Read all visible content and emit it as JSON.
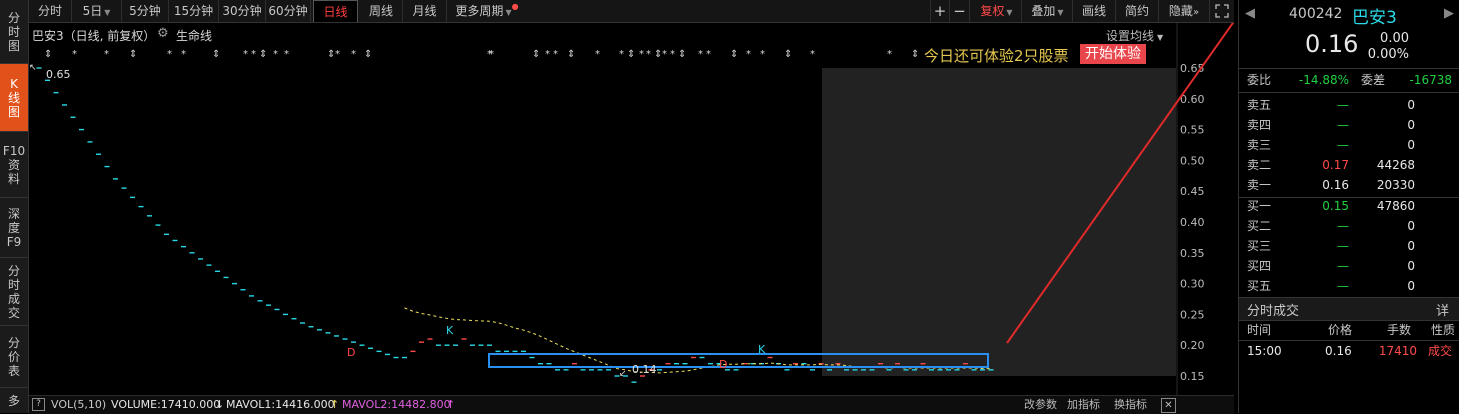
{
  "sidebar": {
    "tabs": [
      {
        "label": "分时图",
        "active": false
      },
      {
        "label": "K线图",
        "active": true
      },
      {
        "label": "F10资料",
        "active": false
      },
      {
        "label": "深度F9",
        "active": false
      },
      {
        "label": "分时成交",
        "active": false
      },
      {
        "label": "分价表",
        "active": false
      },
      {
        "label": "多",
        "active": false
      }
    ]
  },
  "toolbar": {
    "periods": [
      {
        "label": "分时"
      },
      {
        "label": "5日",
        "dropdown": true
      },
      {
        "label": "5分钟"
      },
      {
        "label": "15分钟"
      },
      {
        "label": "30分钟"
      },
      {
        "label": "60分钟"
      },
      {
        "label": "日线",
        "active": true
      },
      {
        "label": "周线"
      },
      {
        "label": "月线"
      },
      {
        "label": "更多周期",
        "dropdown": true
      }
    ],
    "plus": "+",
    "minus": "−",
    "fuquan": "复权",
    "diejia": "叠加",
    "huaxian": "画线",
    "jianyue": "简约",
    "yincang": "隐藏",
    "expand_icon": "expand-icon"
  },
  "chart_header": {
    "title": "巴安3（日线, 前复权）",
    "lifeline": "生命线",
    "setting_ma": "设置均线"
  },
  "chart": {
    "banner": "今日还可体验2只股票",
    "try_button": "开始体验",
    "high_label": "0.65",
    "low_label": "0.14",
    "k_labels": [
      "K",
      "K"
    ],
    "d_labels": [
      "D",
      "D"
    ],
    "y_ticks": [
      "0.65",
      "0.60",
      "0.55",
      "0.50",
      "0.45",
      "0.40",
      "0.35",
      "0.30",
      "0.25",
      "0.20",
      "0.15"
    ],
    "colors": {
      "up": "#ff4a4a",
      "down": "#2ad9e6",
      "ma": "#f0e060",
      "highlight": "#2a8ff0",
      "future_bg": "#222222"
    }
  },
  "chart_data": {
    "type": "candlestick",
    "title": "巴安3（日线, 前复权）",
    "ylim": [
      0.13,
      0.67
    ],
    "closes": [
      0.65,
      0.63,
      0.61,
      0.59,
      0.57,
      0.55,
      0.53,
      0.51,
      0.49,
      0.47,
      0.455,
      0.44,
      0.425,
      0.41,
      0.395,
      0.38,
      0.37,
      0.36,
      0.35,
      0.34,
      0.33,
      0.32,
      0.31,
      0.3,
      0.29,
      0.28,
      0.272,
      0.265,
      0.258,
      0.25,
      0.243,
      0.236,
      0.23,
      0.225,
      0.22,
      0.215,
      0.21,
      0.205,
      0.2,
      0.195,
      0.19,
      0.185,
      0.18,
      0.18,
      0.19,
      0.205,
      0.21,
      0.2,
      0.2,
      0.2,
      0.21,
      0.2,
      0.2,
      0.2,
      0.19,
      0.19,
      0.19,
      0.19,
      0.18,
      0.17,
      0.17,
      0.16,
      0.16,
      0.17,
      0.16,
      0.16,
      0.16,
      0.16,
      0.15,
      0.15,
      0.14,
      0.15,
      0.16,
      0.16,
      0.17,
      0.17,
      0.17,
      0.18,
      0.18,
      0.17,
      0.17,
      0.16,
      0.16,
      0.17,
      0.17,
      0.17,
      0.18,
      0.17,
      0.16,
      0.17,
      0.17,
      0.16,
      0.17,
      0.16,
      0.17,
      0.16,
      0.16,
      0.16,
      0.16,
      0.17,
      0.16,
      0.17,
      0.16,
      0.16,
      0.17,
      0.16,
      0.16,
      0.16,
      0.16,
      0.17,
      0.16,
      0.16,
      0.16
    ],
    "ma_start_index": 43,
    "indicator": {
      "name": "VOL(5,10)",
      "volume": "VOLUME:17410.000",
      "mavol1": "MAVOL1:14416.000",
      "mavol2": "MAVOL2:14482.800"
    }
  },
  "status_bar": {
    "expand": "?",
    "vol_title": "VOL(5,10)",
    "volume": "VOLUME:17410.000",
    "mavol1": "MAVOL1:14416.000",
    "mavol2": "MAVOL2:14482.800",
    "gaicanshu": "改参数",
    "jiazhibiao": "加指标",
    "huanzhibiao": "换指标",
    "close_icon": "close-icon"
  },
  "quote": {
    "code": "400242",
    "name": "巴安3",
    "price": "0.16",
    "change": "0.00",
    "change_pct": "0.00%",
    "weibi_label": "委比",
    "weibi": "-14.88%",
    "weicha_label": "委差",
    "weicha": "-16738",
    "asks": [
      {
        "label": "卖五",
        "price": "—",
        "vol": "0"
      },
      {
        "label": "卖四",
        "price": "—",
        "vol": "0"
      },
      {
        "label": "卖三",
        "price": "—",
        "vol": "0"
      },
      {
        "label": "卖二",
        "price": "0.17",
        "vol": "44268"
      },
      {
        "label": "卖一",
        "price": "0.16",
        "vol": "20330"
      }
    ],
    "bids": [
      {
        "label": "买一",
        "price": "0.15",
        "vol": "47860"
      },
      {
        "label": "买二",
        "price": "—",
        "vol": "0"
      },
      {
        "label": "买三",
        "price": "—",
        "vol": "0"
      },
      {
        "label": "买四",
        "price": "—",
        "vol": "0"
      },
      {
        "label": "买五",
        "price": "—",
        "vol": "0"
      }
    ],
    "trades_title": "分时成交",
    "trades_detail": "详",
    "trades_headers": [
      "时间",
      "价格",
      "手数",
      "性质"
    ],
    "trades": [
      {
        "time": "15:00",
        "price": "0.16",
        "qty": "17410",
        "nature": "成交"
      }
    ]
  }
}
